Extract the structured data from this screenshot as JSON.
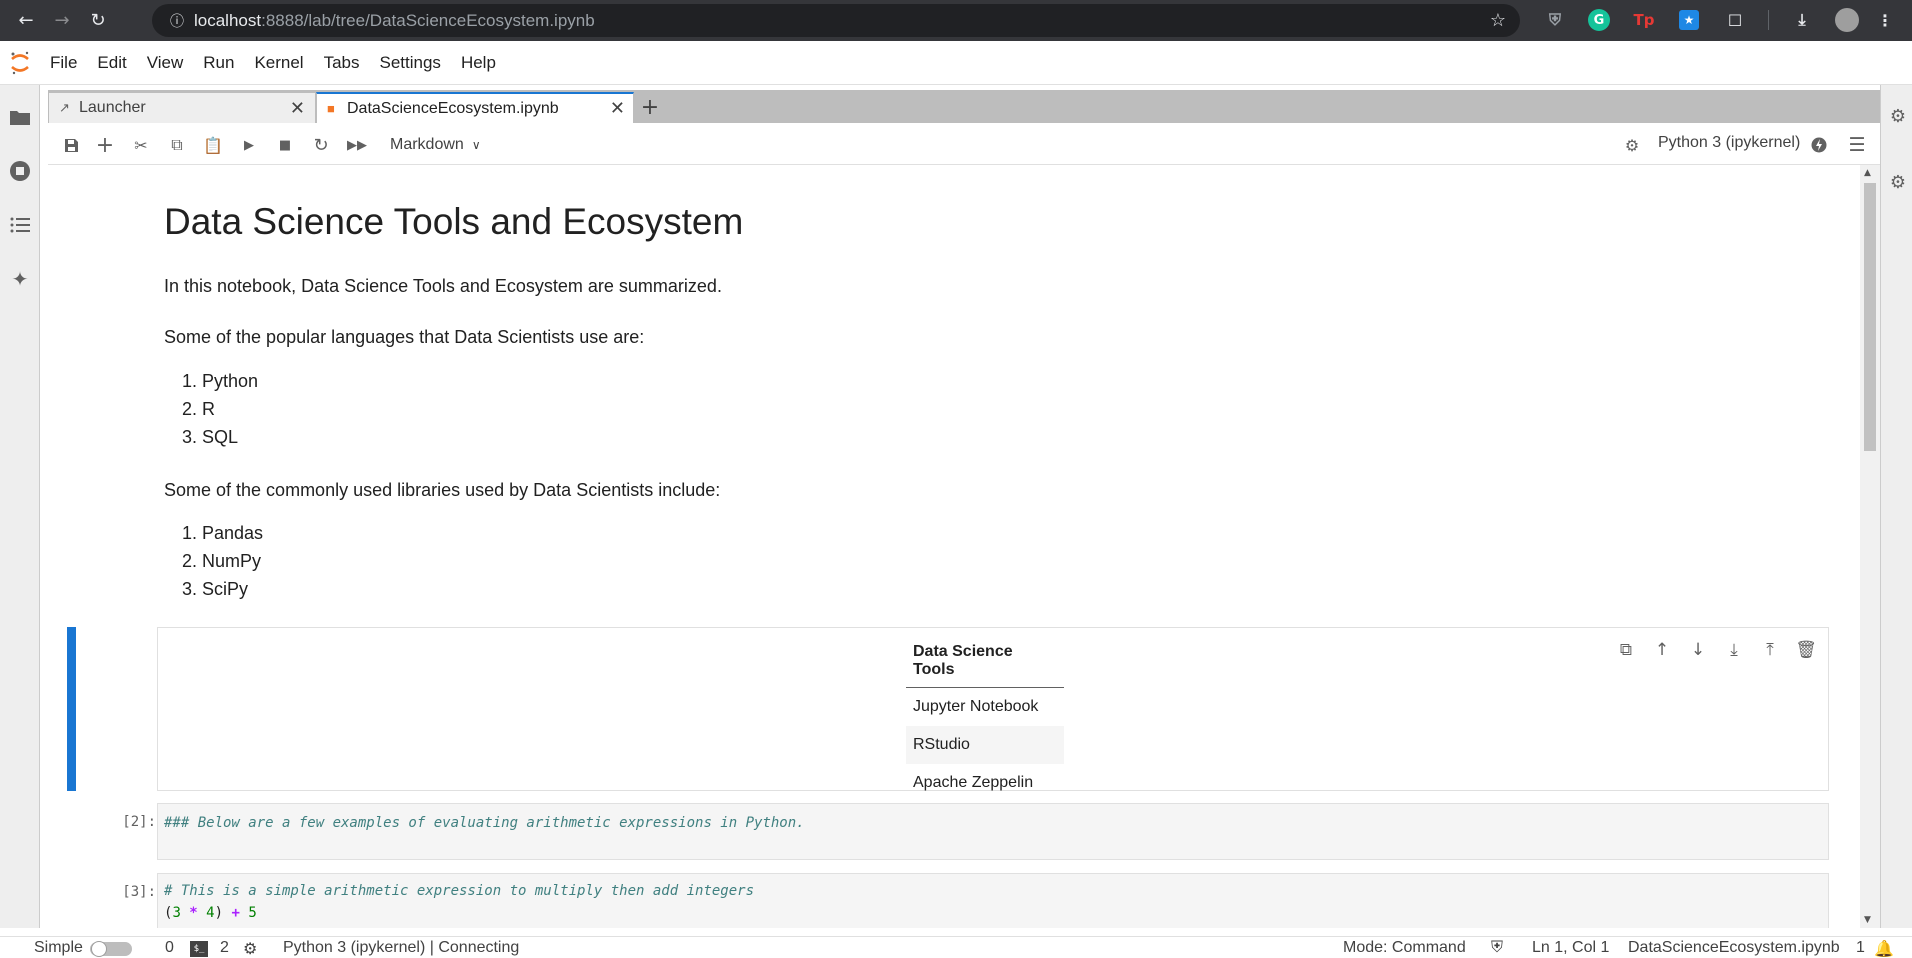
{
  "browser": {
    "url_host": "localhost",
    "url_rest": ":8888/lab/tree/DataScienceEcosystem.ipynb"
  },
  "menubar": {
    "items": [
      "File",
      "Edit",
      "View",
      "Run",
      "Kernel",
      "Tabs",
      "Settings",
      "Help"
    ]
  },
  "tabs": [
    {
      "label": "Launcher",
      "active": false
    },
    {
      "label": "DataScienceEcosystem.ipynb",
      "active": true
    }
  ],
  "toolbar": {
    "cell_type": "Markdown",
    "kernel": "Python 3 (ipykernel)"
  },
  "notebook": {
    "title": "Data Science Tools and Ecosystem",
    "intro": "In this notebook, Data Science Tools and Ecosystem are summarized.",
    "languages_intro": "Some of the popular languages that Data Scientists use are:",
    "languages": [
      "1. Python",
      "2. R",
      "3. SQL"
    ],
    "libraries_intro": "Some of the commonly used libraries used by Data Scientists include:",
    "libraries": [
      "1. Pandas",
      "2. NumPy",
      "3. SciPy"
    ],
    "tools_table": {
      "header": "Data Science Tools",
      "rows": [
        "Jupyter Notebook",
        "RStudio",
        "Apache Zeppelin"
      ]
    },
    "cell2": {
      "prompt": "[2]:",
      "line1": "### Below are a few examples of evaluating arithmetic expressions in Python."
    },
    "cell3": {
      "prompt": "[3]:",
      "line1": "# This is a simple arithmetic expression to multiply then add integers",
      "tok_open": "(",
      "tok_3": "3",
      "tok_mul": " * ",
      "tok_4": "4",
      "tok_close": ") ",
      "tok_plus": "+",
      "tok_5": " 5"
    }
  },
  "statusbar": {
    "mode_label": "Simple",
    "zero": "0",
    "terminals": "2",
    "kernel_status": "Python 3 (ipykernel) | Connecting",
    "mode": "Mode: Command",
    "cursor": "Ln 1, Col 1",
    "filename": "DataScienceEcosystem.ipynb",
    "notifications": "1"
  },
  "colors": {
    "accent": "#1976d2",
    "browser_bg": "#35363a",
    "jupyter_orange": "#f37726"
  }
}
